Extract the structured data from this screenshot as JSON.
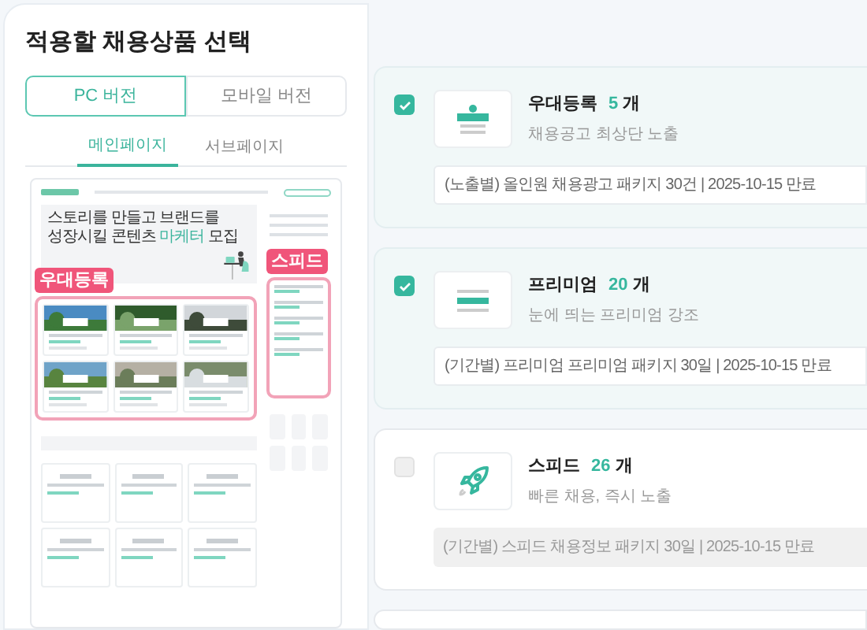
{
  "title": "적용할 채용상품 선택",
  "version_tabs": [
    {
      "label": "PC 버전",
      "selected": true
    },
    {
      "label": "모바일 버전",
      "selected": false
    }
  ],
  "page_tabs": [
    {
      "label": "메인페이지",
      "selected": true
    },
    {
      "label": "서브페이지",
      "selected": false
    }
  ],
  "preview": {
    "banner_headline": "스토리를 만들고 브랜드를",
    "banner_headline_2": "성장시킬 콘텐츠 ",
    "banner_highlight": "마케터",
    "banner_headline_3": " 모집",
    "labels": [
      "우대등록",
      "스피드"
    ]
  },
  "products": [
    {
      "kind": "badge",
      "name": "우대등록",
      "count": "5",
      "unit": "개",
      "description": "채용공고 최상단 노출",
      "package": "(노출별) 올인원 채용광고 패키지 30건 | 2025-10-15 만료",
      "checked": true
    },
    {
      "kind": "bars",
      "name": "프리미엄",
      "count": "20",
      "unit": "개",
      "description": "눈에 띄는 프리미엄 강조",
      "package": "(기간별) 프리미엄 프리미엄 패키지 30일 | 2025-10-15 만료",
      "checked": true
    },
    {
      "kind": "rocket",
      "name": "스피드",
      "count": "26",
      "unit": "개",
      "description": "빠른 채용, 즉시 노출",
      "package": "(기간별) 스피드 채용정보 패키지 30일 | 2025-10-15 만료",
      "checked": false
    }
  ]
}
